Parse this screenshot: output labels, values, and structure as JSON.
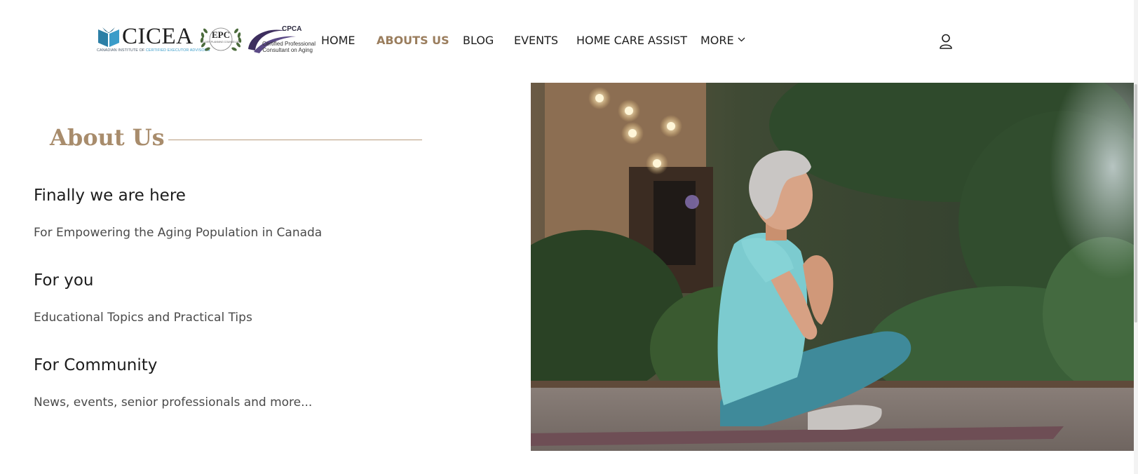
{
  "brand": {
    "logo_cicea_text": "CICEA",
    "logo_cicea_tagline_prefix": "CANADIAN INSTITUTE OF ",
    "logo_cicea_tagline_highlight": "CERTIFIED EXECUTOR ADVISORS",
    "logo_epc_text": "EPC",
    "logo_epc_sub": "ELDER PLANNING COUNSELOR",
    "logo_cpca_text": "CPCA",
    "logo_cpca_line1": "Certified Professional",
    "logo_cpca_line2": "Consultant on Aging"
  },
  "nav": {
    "items": [
      {
        "label": "HOME",
        "active": false
      },
      {
        "label": "ABOUTS US",
        "active": true
      },
      {
        "label": "BLOG",
        "active": false
      },
      {
        "label": "EVENTS",
        "active": false
      },
      {
        "label": "HOME CARE ASSIST",
        "active": false
      },
      {
        "label": "MORE",
        "active": false
      }
    ],
    "user_icon": "user-icon",
    "more_icon": "chevron-down-icon"
  },
  "about": {
    "heading": "About Us",
    "sections": [
      {
        "title": "Finally we are here",
        "subtitle": "For Empowering the Aging Population in Canada"
      },
      {
        "title": "For you",
        "subtitle": "Educational Topics and Practical Tips"
      },
      {
        "title": "For Community",
        "subtitle": "News, events, senior professionals and more..."
      }
    ]
  },
  "colors": {
    "accent": "#a88c6c",
    "nav_active": "#9a7d5d",
    "text": "#1c1c1c",
    "subtext": "#4a4a4a"
  }
}
